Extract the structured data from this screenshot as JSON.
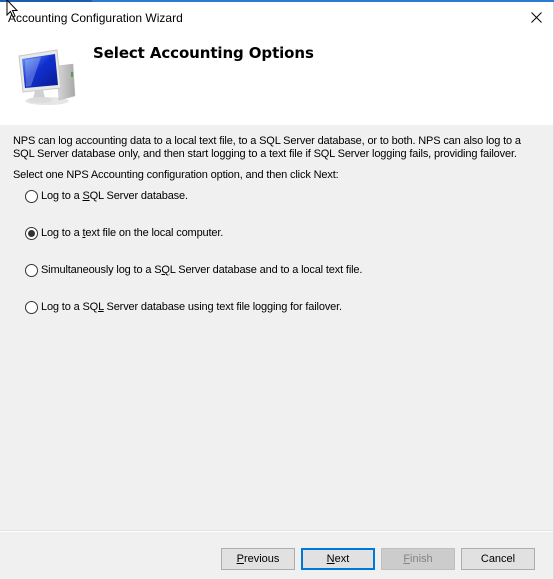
{
  "window": {
    "title": "Accounting Configuration Wizard",
    "close_icon": "close-icon"
  },
  "header": {
    "title": "Select Accounting Options",
    "icon": "computer-monitor-icon"
  },
  "content": {
    "intro": "NPS can log accounting data to a local text file, to a SQL Server database, or to both. NPS can also log to a SQL Server database only, and then start logging to a text file if SQL Server logging fails, providing failover.",
    "prompt": "Select one NPS Accounting configuration option, and then click Next:",
    "selected_option": 1,
    "options": [
      {
        "pre": "Log to a ",
        "key": "S",
        "post": "QL Server database.",
        "checked": false
      },
      {
        "pre": "Log to a ",
        "key": "t",
        "post": "ext file on the local computer.",
        "checked": true
      },
      {
        "pre": "Simultaneously log to a S",
        "key": "Q",
        "post": "L Server database and to a local text file.",
        "checked": false
      },
      {
        "pre": "Log to a SQ",
        "key": "L",
        "post": " Server database using text file logging for failover.",
        "checked": false
      }
    ]
  },
  "buttons": {
    "previous": {
      "key": "P",
      "rest": "revious",
      "enabled": true
    },
    "next": {
      "key": "N",
      "rest": "ext",
      "enabled": true,
      "default": true
    },
    "finish": {
      "key": "F",
      "rest": "inish",
      "enabled": false
    },
    "cancel": {
      "label": "Cancel",
      "enabled": true
    }
  },
  "colors": {
    "accent": "#0078d7",
    "header_bg": "#ffffff",
    "body_bg": "#f0f0f0"
  }
}
